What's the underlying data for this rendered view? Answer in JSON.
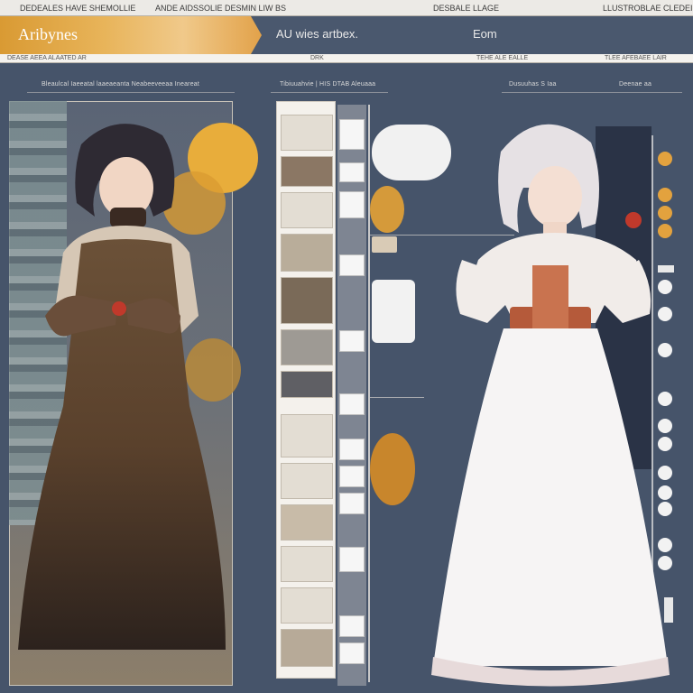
{
  "topbar": {
    "left_text": "DEDEALES HAVE SHEMOLLIE",
    "mid_text": "ANDE AIDSSOLIE DESMIN LIW BS",
    "right1_text": "DESBALE LLAGE",
    "right2_text": "LLUSTROBLAE CLEDEIMITION"
  },
  "header": {
    "brand": "Aribynes",
    "center_label": "AU wies artbex.",
    "right_label": "Eom"
  },
  "subbar": {
    "left_text": "DEASE AEEA ALAATED AR",
    "mid_text": "DRK",
    "right1_text": "TEHE ALE EALLE",
    "right2_text": "TLEE AFEBAEE LAIR"
  },
  "captions": {
    "left": "Bleaulcal Iaeeatal laaeaeanta Neabeeveeaa Ineareat",
    "center": "Tibiuuahvie | HIS DTAB   Aleuaaa",
    "right1": "Dusuuhas S Iaa",
    "right2": "Deenae aa"
  },
  "colors": {
    "accent": "#e3a23e",
    "background": "#46546a",
    "panel_dark": "#2a3346"
  },
  "icons": {
    "dot_gold": "circle-gold",
    "dot_white": "circle-white"
  }
}
